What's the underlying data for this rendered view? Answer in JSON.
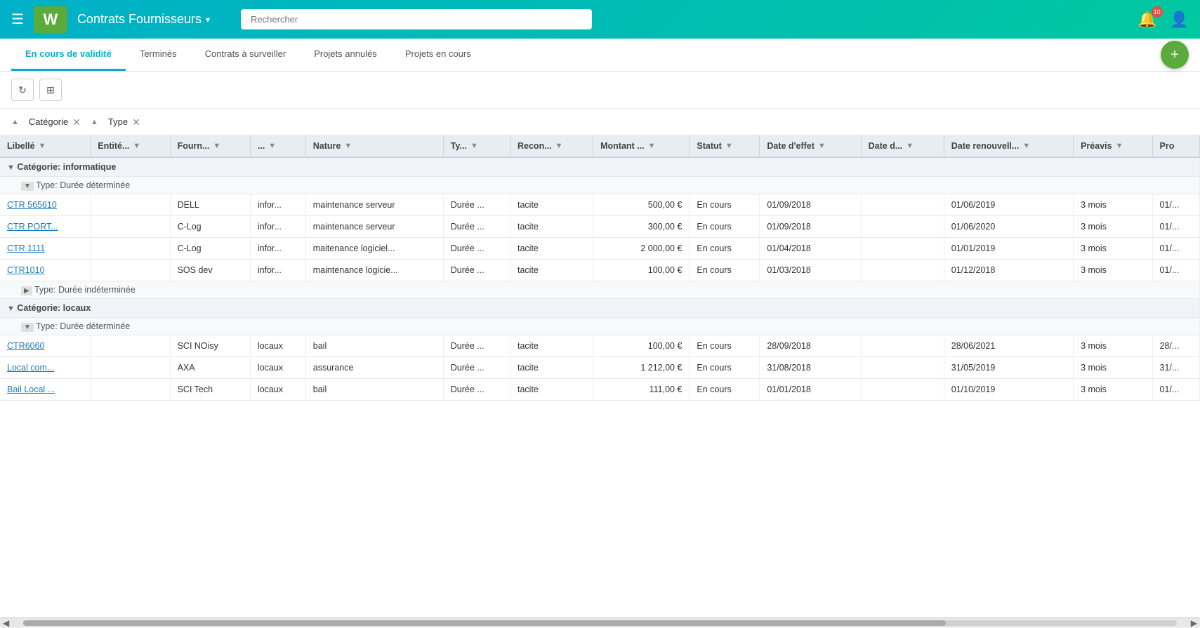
{
  "header": {
    "logo_letter": "W",
    "app_title": "Contrats Fournisseurs",
    "dropdown_arrow": "▾",
    "search_placeholder": "Rechercher",
    "notification_count": "10"
  },
  "tabs": [
    {
      "id": "en-cours",
      "label": "En cours de validité",
      "active": true
    },
    {
      "id": "termines",
      "label": "Terminés",
      "active": false
    },
    {
      "id": "surveiller",
      "label": "Contrats à surveiller",
      "active": false
    },
    {
      "id": "annules",
      "label": "Projets annulés",
      "active": false
    },
    {
      "id": "en-cours-proj",
      "label": "Projets en cours",
      "active": false
    }
  ],
  "toolbar": {
    "refresh_label": "↻",
    "export_label": "⊞"
  },
  "filters": [
    {
      "id": "categorie",
      "label": "Catégorie"
    },
    {
      "id": "type",
      "label": "Type"
    }
  ],
  "table": {
    "columns": [
      {
        "id": "libelle",
        "label": "Libellé"
      },
      {
        "id": "entite",
        "label": "Entité..."
      },
      {
        "id": "fournisseur",
        "label": "Fourn..."
      },
      {
        "id": "extra",
        "label": "..."
      },
      {
        "id": "nature",
        "label": "Nature"
      },
      {
        "id": "type",
        "label": "Ty..."
      },
      {
        "id": "recon",
        "label": "Recon..."
      },
      {
        "id": "montant",
        "label": "Montant ..."
      },
      {
        "id": "statut",
        "label": "Statut"
      },
      {
        "id": "date_effet",
        "label": "Date d'effet"
      },
      {
        "id": "date_d",
        "label": "Date d..."
      },
      {
        "id": "date_renouv",
        "label": "Date renouvell..."
      },
      {
        "id": "preavis",
        "label": "Préavis"
      },
      {
        "id": "pro",
        "label": "Pro"
      }
    ],
    "groups": [
      {
        "id": "informatique",
        "label": "Catégorie: informatique",
        "expanded": true,
        "subgroups": [
          {
            "id": "duree-determinee-1",
            "label": "Type: Durée déterminée",
            "expanded": true,
            "rows": [
              {
                "libelle": "CTR 565610",
                "entite": "",
                "fournisseur": "DELL",
                "extra": "infor...",
                "nature": "maintenance serveur",
                "type": "Durée ...",
                "recon": "tacite",
                "montant": "500,00 €",
                "statut": "En cours",
                "date_effet": "01/09/2018",
                "date_d": "",
                "date_renouv": "01/06/2019",
                "preavis": "3 mois",
                "pro": "01/..."
              },
              {
                "libelle": "CTR PORT...",
                "entite": "",
                "fournisseur": "C-Log",
                "extra": "infor...",
                "nature": "maintenance serveur",
                "type": "Durée ...",
                "recon": "tacite",
                "montant": "300,00 €",
                "statut": "En cours",
                "date_effet": "01/09/2018",
                "date_d": "",
                "date_renouv": "01/06/2020",
                "preavis": "3 mois",
                "pro": "01/..."
              },
              {
                "libelle": "CTR 1111",
                "entite": "",
                "fournisseur": "C-Log",
                "extra": "infor...",
                "nature": "maitenance logiciel...",
                "type": "Durée ...",
                "recon": "tacite",
                "montant": "2 000,00 €",
                "statut": "En cours",
                "date_effet": "01/04/2018",
                "date_d": "",
                "date_renouv": "01/01/2019",
                "preavis": "3 mois",
                "pro": "01/..."
              },
              {
                "libelle": "CTR1010",
                "entite": "",
                "fournisseur": "SOS dev",
                "extra": "infor...",
                "nature": "maintenance logicie...",
                "type": "Durée ...",
                "recon": "tacite",
                "montant": "100,00 €",
                "statut": "En cours",
                "date_effet": "01/03/2018",
                "date_d": "",
                "date_renouv": "01/12/2018",
                "preavis": "3 mois",
                "pro": "01/..."
              }
            ]
          },
          {
            "id": "duree-indeterminee-1",
            "label": "Type: Durée indéterminée",
            "expanded": false,
            "rows": []
          }
        ]
      },
      {
        "id": "locaux",
        "label": "Catégorie: locaux",
        "expanded": true,
        "subgroups": [
          {
            "id": "duree-determinee-2",
            "label": "Type: Durée déterminée",
            "expanded": true,
            "rows": [
              {
                "libelle": "CTR6060",
                "entite": "",
                "fournisseur": "SCI NOisy",
                "extra": "locaux",
                "nature": "bail",
                "type": "Durée ...",
                "recon": "tacite",
                "montant": "100,00 €",
                "statut": "En cours",
                "date_effet": "28/09/2018",
                "date_d": "",
                "date_renouv": "28/06/2021",
                "preavis": "3 mois",
                "pro": "28/..."
              },
              {
                "libelle": "Local com...",
                "entite": "",
                "fournisseur": "AXA",
                "extra": "locaux",
                "nature": "assurance",
                "type": "Durée ...",
                "recon": "tacite",
                "montant": "1 212,00 €",
                "statut": "En cours",
                "date_effet": "31/08/2018",
                "date_d": "",
                "date_renouv": "31/05/2019",
                "preavis": "3 mois",
                "pro": "31/..."
              },
              {
                "libelle": "Bail Local ...",
                "entite": "",
                "fournisseur": "SCI Tech",
                "extra": "locaux",
                "nature": "bail",
                "type": "Durée ...",
                "recon": "tacite",
                "montant": "111,00 €",
                "statut": "En cours",
                "date_effet": "01/01/2018",
                "date_d": "",
                "date_renouv": "01/10/2019",
                "preavis": "3 mois",
                "pro": "01/..."
              }
            ]
          }
        ]
      }
    ]
  }
}
